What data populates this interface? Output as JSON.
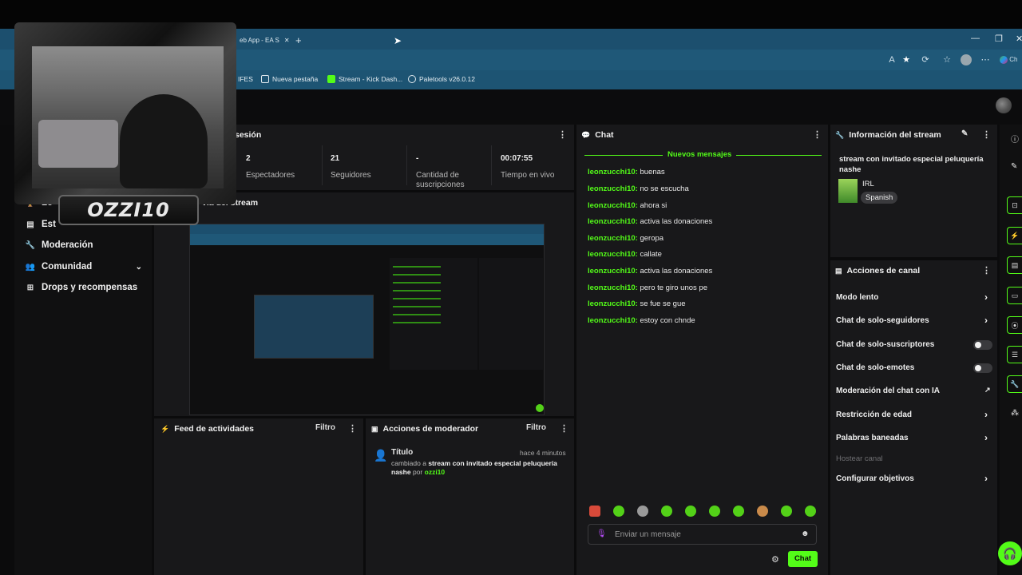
{
  "browser": {
    "tabs": [
      "eb App - EA S"
    ],
    "new_tab_symbol": "+",
    "bookmarks": [
      "IFES",
      "Nueva pestaña",
      "Stream - Kick Dash...",
      "Paletools v26.0.12"
    ],
    "profile_label": "Ch"
  },
  "webcam": {
    "name": "OZZI10"
  },
  "sidebar": {
    "items": [
      {
        "label": "Lo",
        "icon": "trophy-icon"
      },
      {
        "label": "Est",
        "icon": "stats-icon"
      },
      {
        "label": "Moderación",
        "icon": "wrench-icon"
      },
      {
        "label": "Comunidad",
        "icon": "people-icon"
      },
      {
        "label": "Drops y recompensas",
        "icon": "gift-icon"
      }
    ]
  },
  "session": {
    "title": "sesión",
    "stats": [
      {
        "value": "2",
        "label": "Espectadores"
      },
      {
        "value": "21",
        "label": "Seguidores"
      },
      {
        "value": "-",
        "label": "Cantidad de suscripciones"
      },
      {
        "value": "00:07:55",
        "label": "Tiempo en vivo"
      }
    ]
  },
  "preview": {
    "title": "via del stream"
  },
  "activity_feed": {
    "title": "Feed de actividades",
    "filter": "Filtro"
  },
  "mod_actions": {
    "title": "Acciones de moderador",
    "filter": "Filtro",
    "entry": {
      "title": "Título",
      "time": "hace 4 minutos",
      "prefix": "cambiado a",
      "value": "stream con invitado especial peluquería nashe",
      "by": "por",
      "user": "ozzi10"
    }
  },
  "chat": {
    "title": "Chat",
    "new_messages": "Nuevos mensajes",
    "messages": [
      {
        "user": "leonzucchi10:",
        "text": "buenas"
      },
      {
        "user": "leonzucchi10:",
        "text": "no se escucha"
      },
      {
        "user": "leonzucchi10:",
        "text": "ahora si"
      },
      {
        "user": "leonzucchi10:",
        "text": "activa las donaciones"
      },
      {
        "user": "leonzucchi10:",
        "text": "geropa"
      },
      {
        "user": "leonzucchi10:",
        "text": "callate"
      },
      {
        "user": "leonzucchi10:",
        "text": "activa las donaciones"
      },
      {
        "user": "leonzucchi10:",
        "text": "pero te giro unos pe"
      },
      {
        "user": "leonzucchi10:",
        "text": "se fue se gue"
      },
      {
        "user": "leonzucchi10:",
        "text": "estoy con chnde"
      }
    ],
    "input_placeholder": "Enviar un mensaje",
    "send_label": "Chat"
  },
  "stream_info": {
    "title": "Información del stream",
    "stream_title": "stream con invitado especial peluquería nashe",
    "category": "IRL",
    "language": "Spanish"
  },
  "channel_actions": {
    "title": "Acciones de canal",
    "items": [
      {
        "label": "Modo lento",
        "control": "chevron"
      },
      {
        "label": "Chat de solo-seguidores",
        "control": "chevron"
      },
      {
        "label": "Chat de solo-suscriptores",
        "control": "toggle"
      },
      {
        "label": "Chat de solo-emotes",
        "control": "toggle"
      },
      {
        "label": "Moderación del chat con IA",
        "control": "external"
      },
      {
        "label": "Restricción de edad",
        "control": "chevron"
      },
      {
        "label": "Palabras baneadas",
        "control": "chevron"
      },
      {
        "label": "Hostear canal",
        "control": "none",
        "disabled": true
      },
      {
        "label": "Configurar objetivos",
        "control": "chevron"
      }
    ]
  },
  "colors": {
    "accent": "#53fc18",
    "panel": "#18181a",
    "background": "#0b0b0c"
  }
}
